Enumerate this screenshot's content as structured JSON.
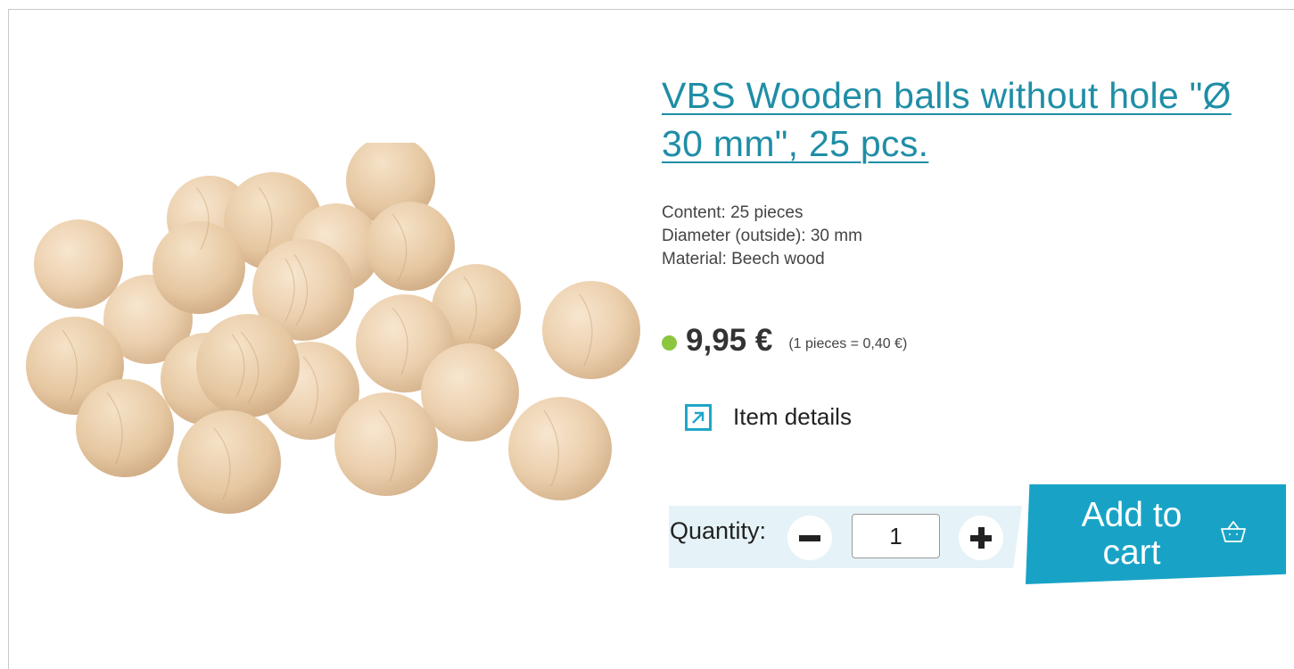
{
  "product": {
    "title": "VBS Wooden balls without hole \"Ø 30 mm\", 25 pcs.",
    "image_alt": "wooden-balls-photo",
    "specs": [
      "Content: 25 pieces",
      "Diameter (outside): 30 mm",
      "Material: Beech wood"
    ],
    "price": "9,95 €",
    "unit_price": "(1 pieces = 0,40 €)",
    "availability_color": "#8cc63f"
  },
  "details_link": {
    "label": "Item details",
    "icon": "external-arrow-icon"
  },
  "quantity": {
    "label": "Quantity:",
    "value": "1",
    "minus_icon": "minus-icon",
    "plus_icon": "plus-icon"
  },
  "cart": {
    "label": "Add to cart",
    "icon": "basket-icon",
    "color": "#18a3c6"
  },
  "colors": {
    "accent": "#1f8ea6",
    "panel": "#e5f3f8"
  }
}
